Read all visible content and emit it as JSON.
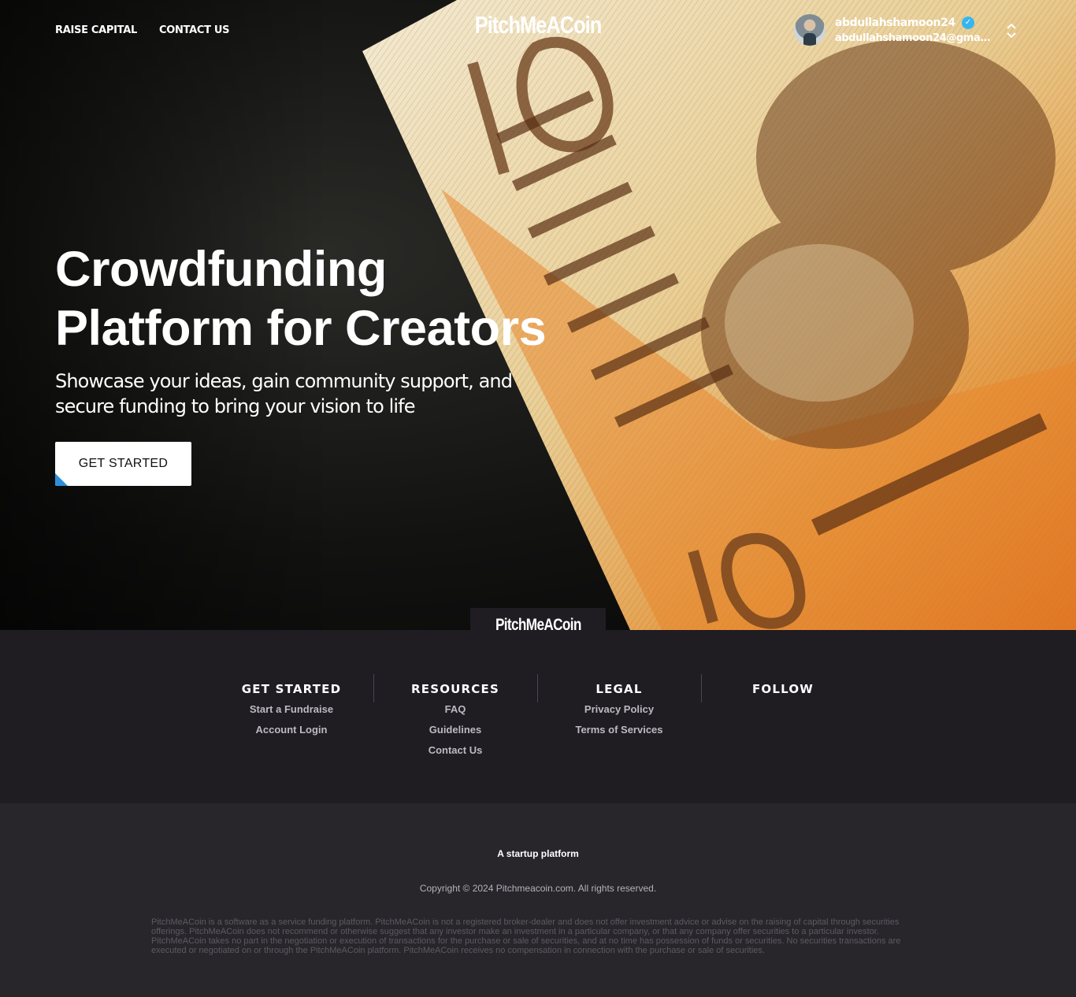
{
  "nav": {
    "raise_capital": "RAISE CAPITAL",
    "contact_us": "CONTACT US"
  },
  "brand": {
    "name": "PitchMeACoin"
  },
  "user": {
    "username": "abdullahshamoon24",
    "email": "abdullahshamoon24@gmail.c...",
    "verified": true
  },
  "hero": {
    "headline_line1": "Crowdfunding",
    "headline_line2": "Platform for Creators",
    "subheading": "Showcase your ideas, gain community support, and secure funding to bring your vision to life",
    "cta_label": "GET STARTED"
  },
  "footer": {
    "logo": "PitchMeACoin",
    "columns": [
      {
        "title": "GET STARTED",
        "links": [
          "Start a Fundraise",
          "Account Login"
        ]
      },
      {
        "title": "RESOURCES",
        "links": [
          "FAQ",
          "Guidelines",
          "Contact Us"
        ]
      },
      {
        "title": "LEGAL",
        "links": [
          "Privacy Policy",
          "Terms of Services"
        ]
      },
      {
        "title": "FOLLOW",
        "links": []
      }
    ],
    "tagline": "A startup platform",
    "copyright": "Copyright © 2024 Pitchmeacoin.com. All rights reserved.",
    "disclaimer": "PitchMeACoin is a software as a service funding platform. PitchMeACoin is not a registered broker-dealer and does not offer investment advice or advise on the raising of capital through securities offerings. PitchMeACoin does not recommend or otherwise suggest that any investor make an investment in a particular company, or that any company offer securities to a particular investor. PitchMeACoin takes no part in the negotiation or execution of transactions for the purchase or sale of securities, and at no time has possession of funds or securities. No securities transactions are executed or negotiated on or through the PitchMeACoin platform. PitchMeACoin receives no compensation in connection with the purchase or sale of securities."
  },
  "colors": {
    "accent_blue": "#2f8fd8",
    "verified_badge": "#35b6f0",
    "footer_bg": "#1f1c22",
    "bottom_bg": "#28252b"
  }
}
